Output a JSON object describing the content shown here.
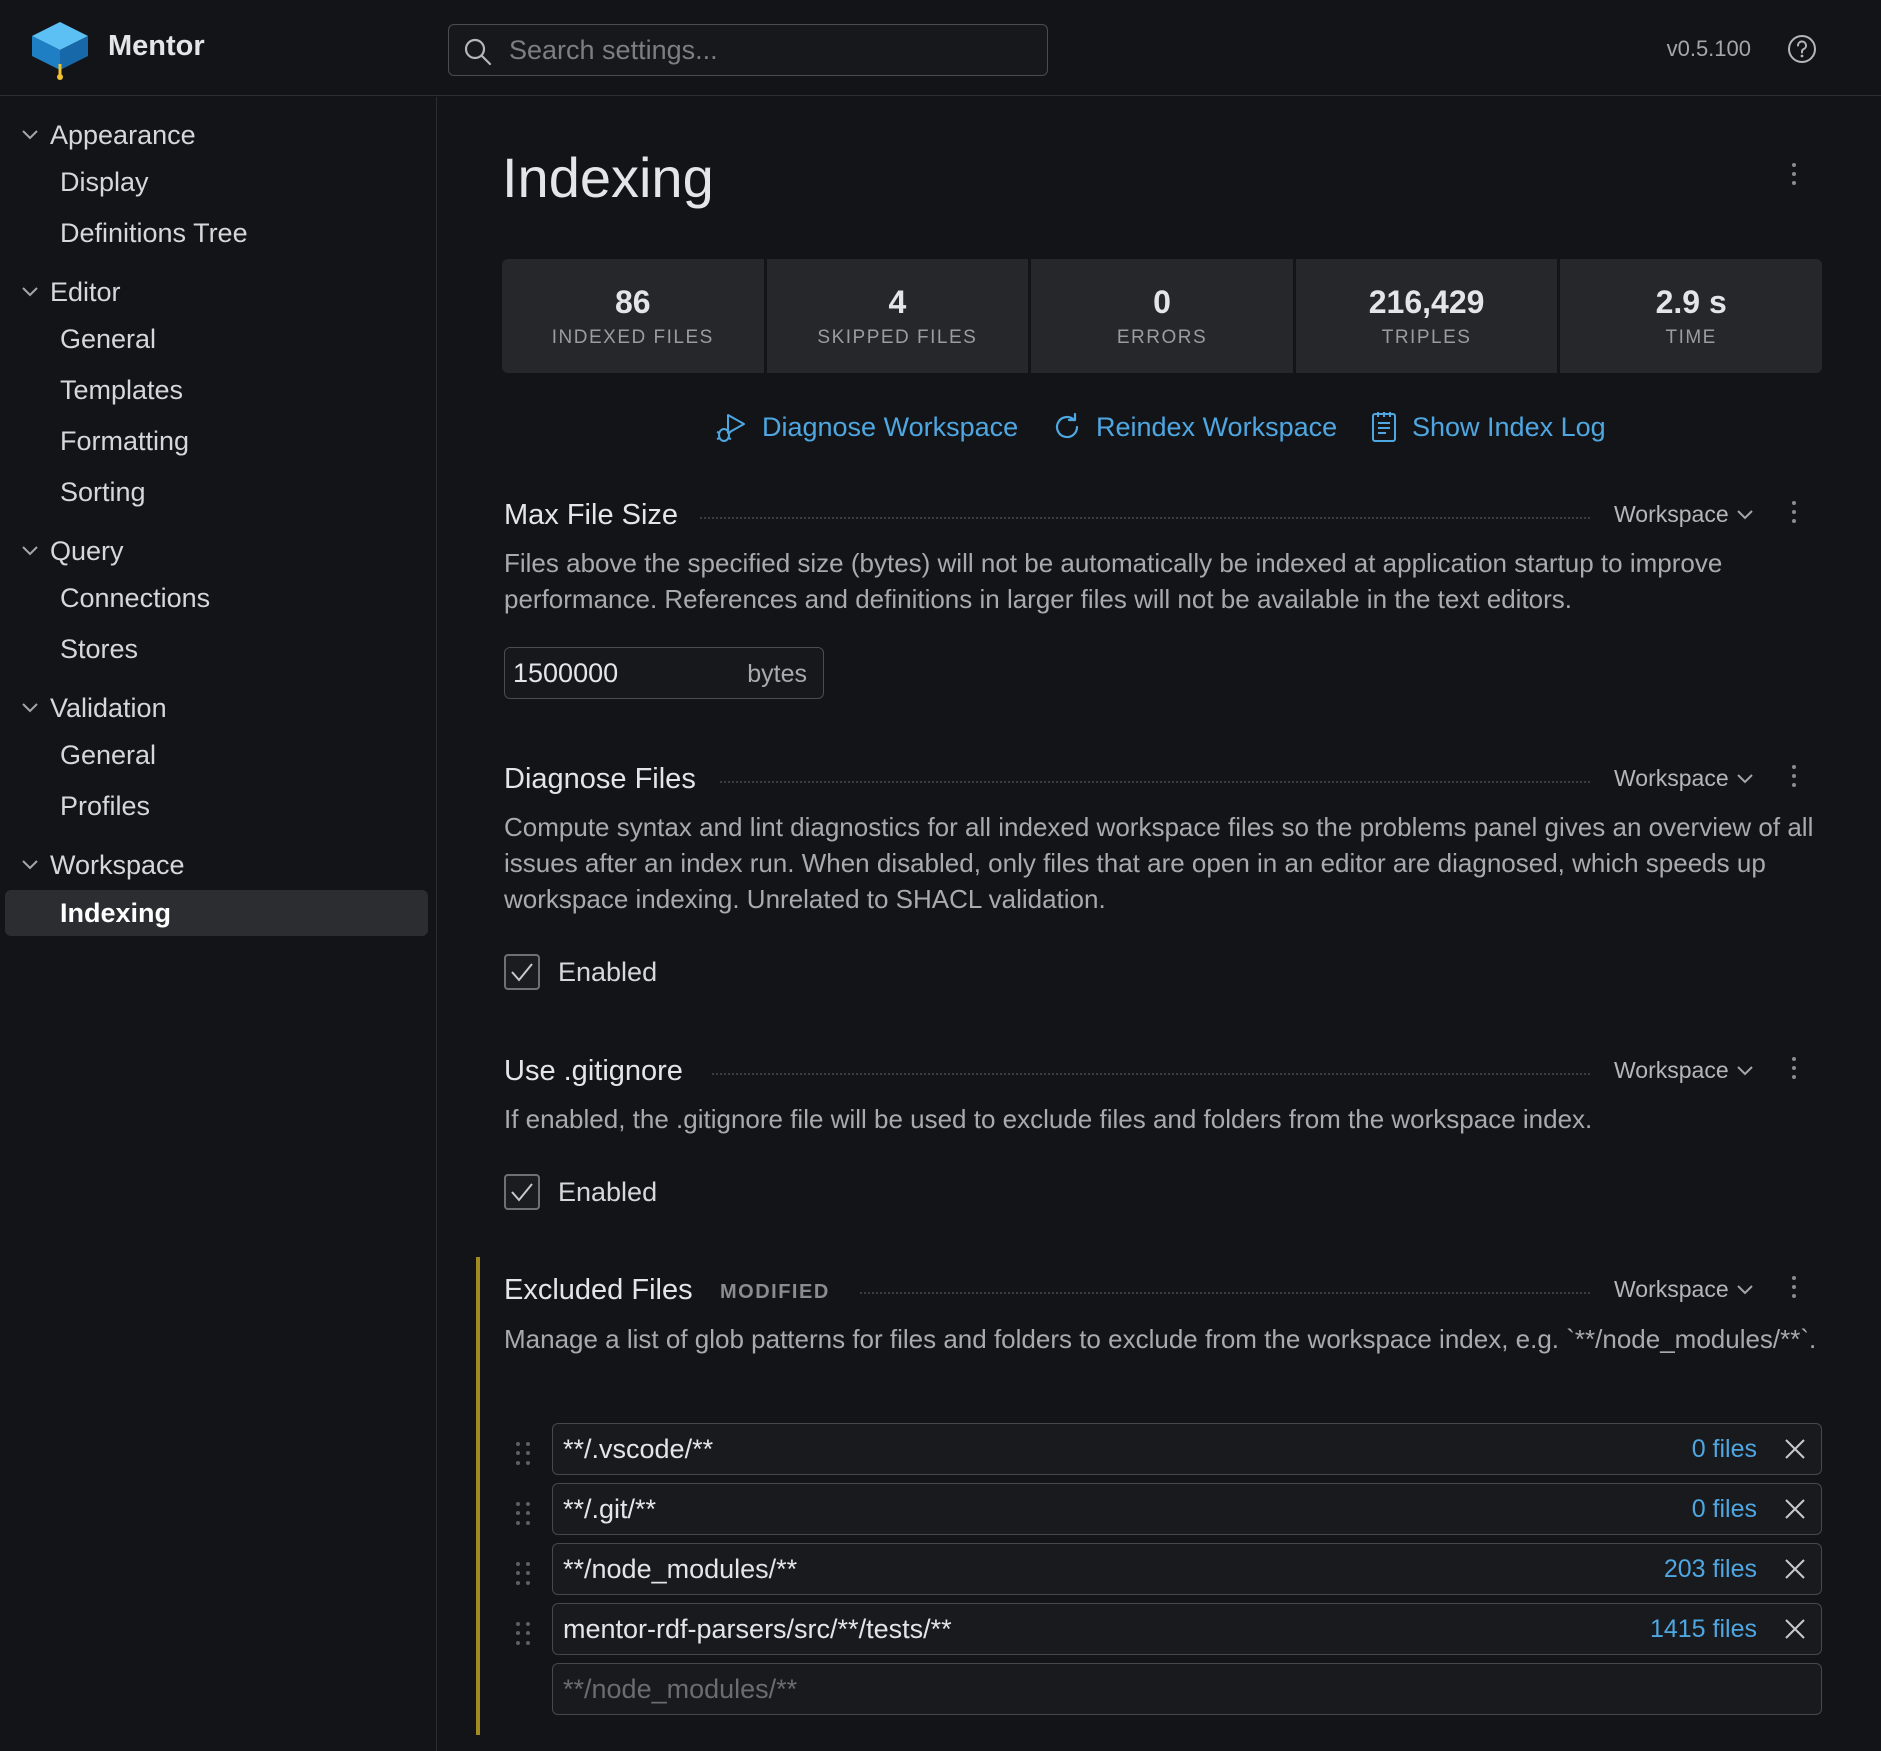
{
  "app": {
    "title": "Mentor",
    "version": "v0.5.100"
  },
  "search": {
    "placeholder": "Search settings..."
  },
  "sidebar": {
    "groups": [
      {
        "label": "Appearance",
        "items": [
          "Display",
          "Definitions Tree"
        ]
      },
      {
        "label": "Editor",
        "items": [
          "General",
          "Templates",
          "Formatting",
          "Sorting"
        ]
      },
      {
        "label": "Query",
        "items": [
          "Connections",
          "Stores"
        ]
      },
      {
        "label": "Validation",
        "items": [
          "General",
          "Profiles"
        ]
      },
      {
        "label": "Workspace",
        "items": [
          "Indexing"
        ]
      }
    ],
    "active_item": "Indexing"
  },
  "page": {
    "title": "Indexing"
  },
  "stats": [
    {
      "value": "86",
      "label": "INDEXED FILES"
    },
    {
      "value": "4",
      "label": "SKIPPED FILES"
    },
    {
      "value": "0",
      "label": "ERRORS"
    },
    {
      "value": "216,429",
      "label": "TRIPLES"
    },
    {
      "value": "2.9 s",
      "label": "TIME"
    }
  ],
  "actions": {
    "diagnose": "Diagnose Workspace",
    "reindex": "Reindex Workspace",
    "log": "Show Index Log"
  },
  "settings": {
    "max_file_size": {
      "title": "Max File Size",
      "scope": "Workspace",
      "description": "Files above the specified size (bytes) will not be automatically be indexed at application startup to improve performance. References and definitions in larger files will not be available in the text editors.",
      "value": "1500000",
      "unit": "bytes"
    },
    "diagnose_files": {
      "title": "Diagnose Files",
      "scope": "Workspace",
      "description": "Compute syntax and lint diagnostics for all indexed workspace files so the problems panel gives an overview of all issues after an index run. When disabled, only files that are open in an editor are diagnosed, which speeds up workspace indexing. Unrelated to SHACL validation.",
      "checkbox_label": "Enabled",
      "checked": true
    },
    "use_gitignore": {
      "title": "Use .gitignore",
      "scope": "Workspace",
      "description": "If enabled, the .gitignore file will be used to exclude files and folders from the workspace index.",
      "checkbox_label": "Enabled",
      "checked": true
    },
    "excluded_files": {
      "title": "Excluded Files",
      "badge": "MODIFIED",
      "scope": "Workspace",
      "description": "Manage a list of glob patterns for files and folders to exclude from the workspace index, e.g. `**/node_modules/**`.",
      "patterns": [
        {
          "pattern": "**/.vscode/**",
          "count": "0 files"
        },
        {
          "pattern": "**/.git/**",
          "count": "0 files"
        },
        {
          "pattern": "**/node_modules/**",
          "count": "203 files"
        },
        {
          "pattern": "mentor-rdf-parsers/src/**/tests/**",
          "count": "1415 files"
        }
      ],
      "new_placeholder": "**/node_modules/**"
    }
  },
  "colors": {
    "accent": "#4fa7e2",
    "modified_bar": "#a18a1f",
    "background": "#131417"
  }
}
